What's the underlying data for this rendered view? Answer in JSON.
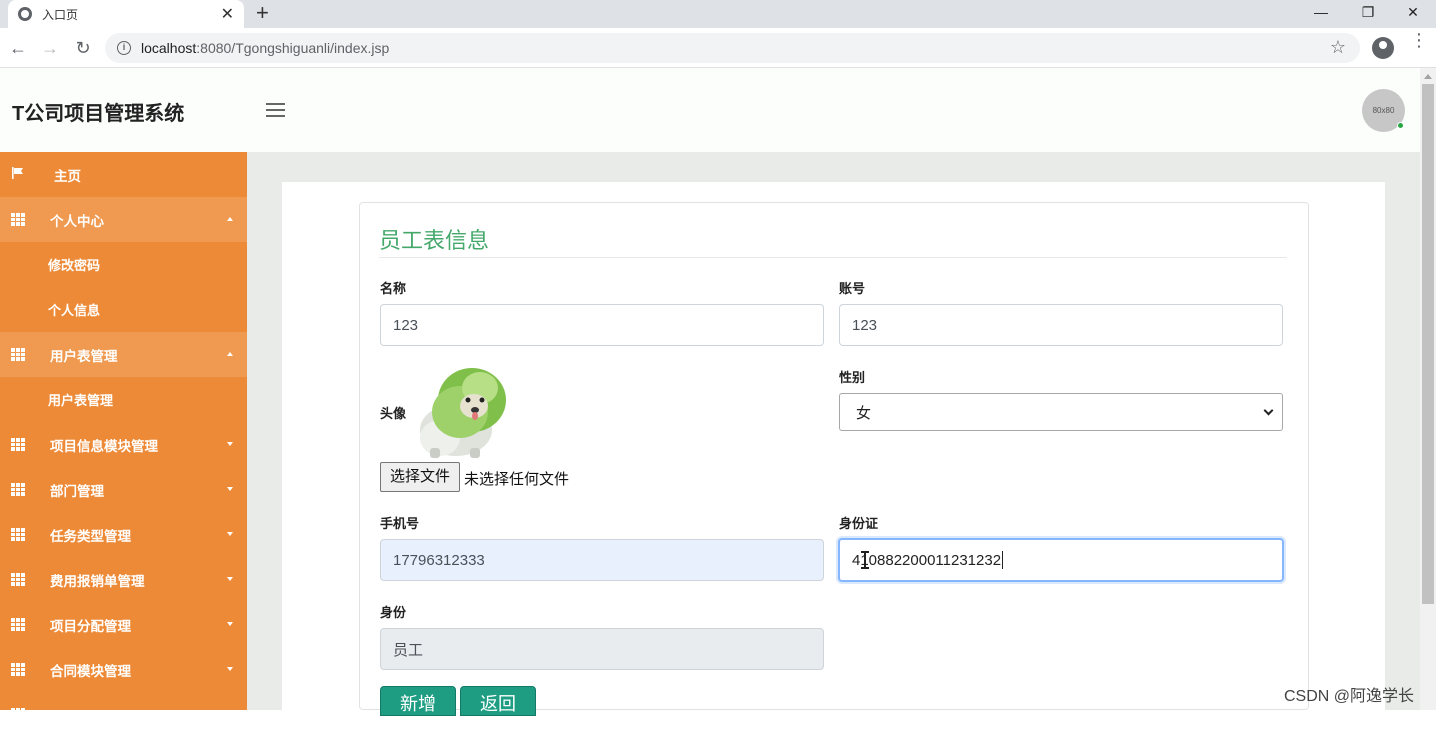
{
  "browser": {
    "tab_title": "入口页",
    "tab_close": "✕",
    "new_tab": "+",
    "url_host": "localhost",
    "url_path": ":8080/Tgongshiguanli/index.jsp",
    "window_minimize": "—",
    "window_restore": "❐",
    "window_close": "✕"
  },
  "header": {
    "brand": "T公司项目管理系统",
    "avatar_text": "80x80"
  },
  "sidebar": {
    "items": [
      {
        "label": "主页",
        "icon": "flag-icon"
      },
      {
        "label": "个人中心",
        "icon": "grid-icon",
        "expanded": true
      },
      {
        "label": "修改密码",
        "sub": true
      },
      {
        "label": "个人信息",
        "sub": true
      },
      {
        "label": "用户表管理",
        "icon": "grid-icon",
        "expanded": true
      },
      {
        "label": "用户表管理",
        "sub": true
      },
      {
        "label": "项目信息模块管理",
        "icon": "grid-icon"
      },
      {
        "label": "部门管理",
        "icon": "grid-icon"
      },
      {
        "label": "任务类型管理",
        "icon": "grid-icon"
      },
      {
        "label": "费用报销单管理",
        "icon": "grid-icon"
      },
      {
        "label": "项目分配管理",
        "icon": "grid-icon"
      },
      {
        "label": "合同模块管理",
        "icon": "grid-icon"
      }
    ]
  },
  "form": {
    "title": "员工表信息",
    "name_label": "名称",
    "name_value": "123",
    "account_label": "账号",
    "account_value": "123",
    "avatar_label": "头像",
    "gender_label": "性别",
    "gender_value": "女",
    "file_button": "选择文件",
    "file_status": "未选择任何文件",
    "phone_label": "手机号",
    "phone_value": "17796312333",
    "idcard_label": "身份证",
    "idcard_value": "410882200011231232",
    "role_label": "身份",
    "role_value": "员工",
    "add_button": "新增",
    "back_button": "返回"
  },
  "watermark": "CSDN @阿逸学长",
  "colors": {
    "sidebar": "#ed8a37",
    "title_green": "#45a86b",
    "button_teal": "#1e9d83"
  }
}
